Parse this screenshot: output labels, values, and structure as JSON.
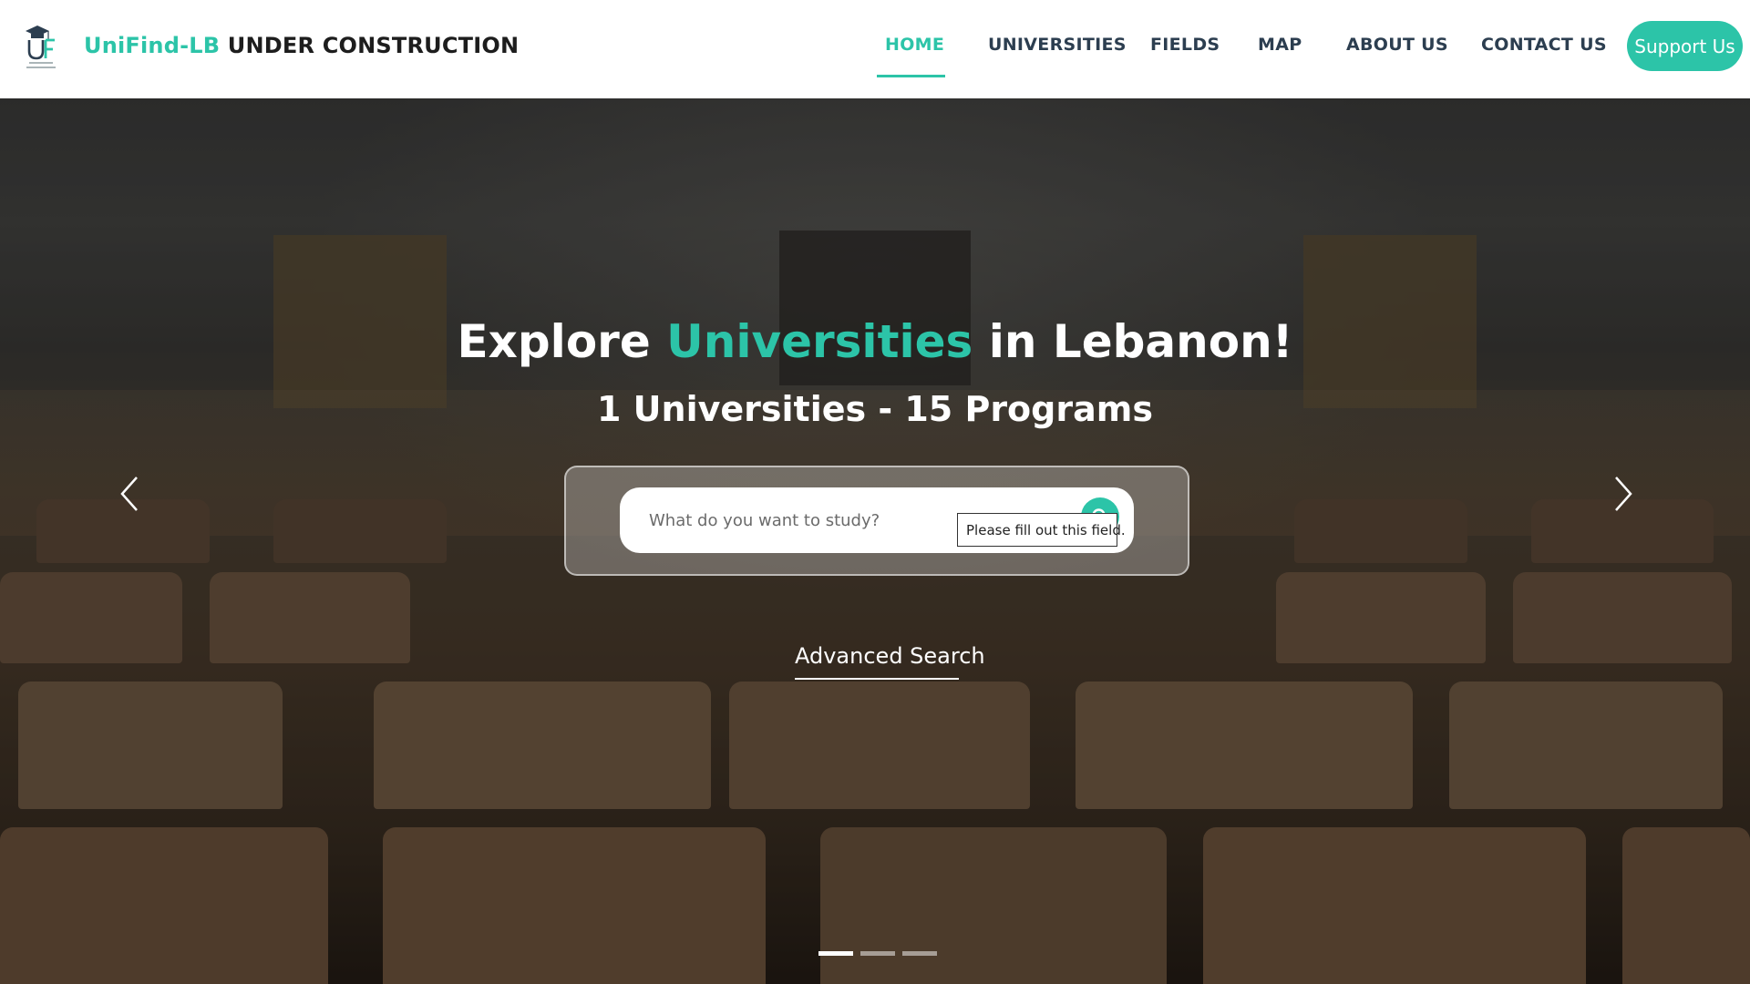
{
  "brand": {
    "name_accent": "UniFind-LB",
    "name_rest": "UNDER CONSTRUCTION",
    "logo_icon": "graduation-cap-uf-logo"
  },
  "nav": {
    "items": [
      {
        "label": "HOME",
        "active": true
      },
      {
        "label": "UNIVERSITIES",
        "active": false
      },
      {
        "label": "FIELDS",
        "active": false
      },
      {
        "label": "MAP",
        "active": false
      },
      {
        "label": "ABOUT US",
        "active": false
      },
      {
        "label": "CONTACT US",
        "active": false
      }
    ],
    "support_label": "Support Us"
  },
  "hero": {
    "title_pre": "Explore",
    "title_accent": "Universities",
    "title_post": "in Lebanon!",
    "subtitle": "1 Universities - 15 Programs",
    "search_placeholder": "What do you want to study?",
    "search_value": "",
    "validation_tooltip": "Please fill out this field.",
    "advanced_search_label": "Advanced Search",
    "carousel": {
      "slides": 3,
      "active_slide": 1
    }
  },
  "colors": {
    "accent": "#2cc4a8",
    "nav_text": "#2c3e50",
    "white": "#ffffff"
  },
  "icons": [
    "search-icon",
    "chevron-left-icon",
    "chevron-right-icon",
    "logo-icon"
  ]
}
